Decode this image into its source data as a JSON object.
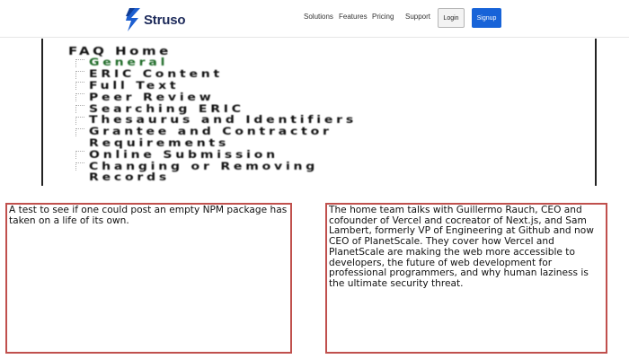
{
  "navbar": {
    "logo_text": "Struso",
    "links": [
      "Solutions",
      "Features",
      "Pricing",
      "Support"
    ],
    "login_label": "Login",
    "signup_label": "Signup",
    "colors": {
      "logo_text": "#1d2a5a",
      "signup_bg": "#1763d8"
    }
  },
  "faq": {
    "title": "FAQ Home",
    "items": [
      {
        "label": "General",
        "active": true
      },
      {
        "label": "ERIC Content",
        "active": false
      },
      {
        "label": "Full Text",
        "active": false
      },
      {
        "label": "Peer Review",
        "active": false
      },
      {
        "label": "Searching ERIC",
        "active": false
      },
      {
        "label": "Thesaurus and Identifiers",
        "active": false
      },
      {
        "label": "Grantee and Contractor",
        "active": false
      },
      {
        "label": "Requirements",
        "active": false
      },
      {
        "label": "Online Submission",
        "active": false
      },
      {
        "label": "Changing or Removing",
        "active": false
      },
      {
        "label": "Records",
        "active": false
      }
    ],
    "colors": {
      "active": "#1f6b28",
      "text": "#111111"
    }
  },
  "cards": [
    {
      "text": "A test to see if one could post an empty NPM package has taken on a life of its own."
    },
    {
      "text": "The home team talks with Guillermo Rauch, CEO and cofounder of Vercel and cocreator of Next.js, and Sam Lambert, formerly VP of Engineering at Github and now CEO of PlanetScale. They cover how Vercel and PlanetScale are making the web more accessible to developers, the future of web development for professional programmers, and why human laziness is the ultimate security threat."
    }
  ],
  "card_border_color": "#c0504d"
}
